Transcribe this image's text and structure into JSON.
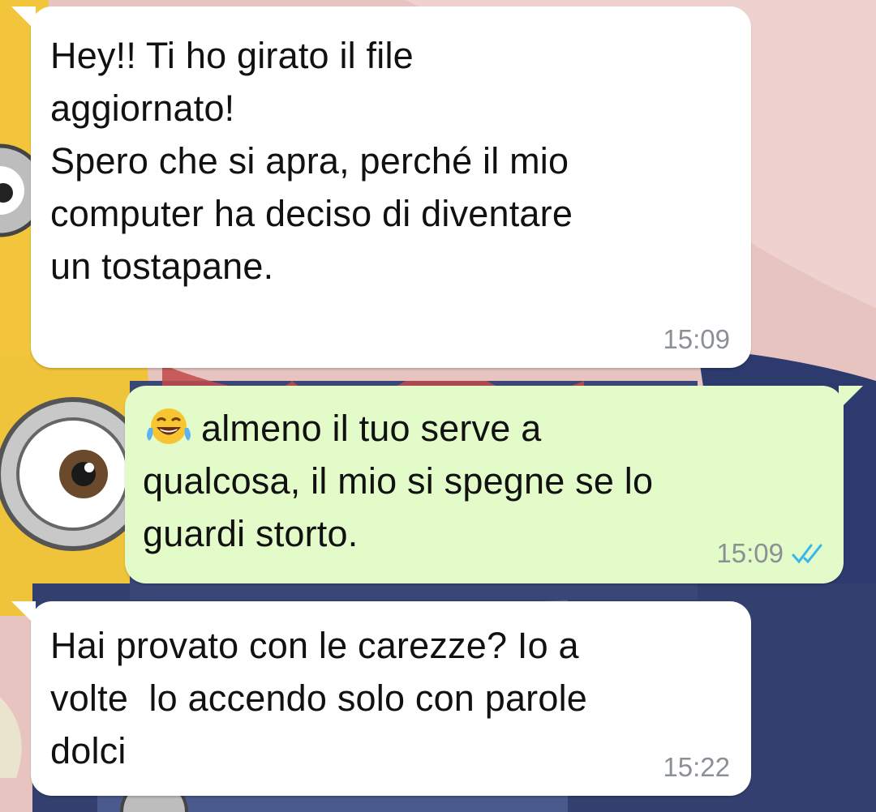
{
  "chat": {
    "messages": [
      {
        "direction": "incoming",
        "text": "Hey!! Ti ho girato il file\naggiornato!\nSpero che si apra, perché il mio\ncomputer ha deciso di diventare\nun tostapane.",
        "time": "15:09"
      },
      {
        "direction": "outgoing",
        "emoji": "tears-of-joy-emoji",
        "text": "almeno il tuo serve a\nqualcosa, il mio si spegne se lo\nguardi storto.",
        "time": "15:09",
        "status": "read",
        "status_icon": "double-check-icon",
        "status_color": "#34b7f1"
      },
      {
        "direction": "incoming",
        "text": "Hai provato con le carezze? Io a\nvolte  lo accendo solo con parole\ndolci",
        "time": "15:22"
      }
    ]
  },
  "theme": {
    "incoming_bubble": "#ffffff",
    "outgoing_bubble": "#e2fbc8",
    "timestamp_color": "#8b9096",
    "wallpaper": "cartoon-minions-wallpaper"
  }
}
